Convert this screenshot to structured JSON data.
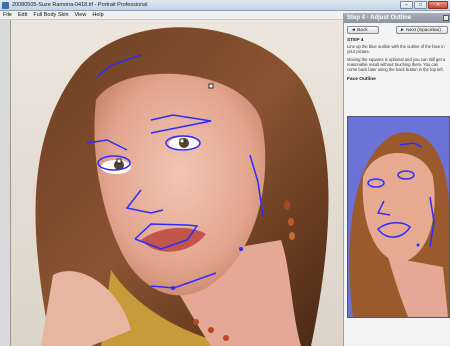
{
  "window": {
    "title": "20080505-Suze Ramona-0418.tif - Portrait Professional",
    "minimize_label": "–",
    "maximize_label": "□",
    "close_label": "✕"
  },
  "menu": {
    "items": [
      "File",
      "Edit",
      "Full Body Skin",
      "View",
      "Help"
    ]
  },
  "panel": {
    "header": "Step 4 - Adjust Outline",
    "back_label": "◄ Back",
    "next_label": "► Next (Spacebar)",
    "step_title": "STEP 4",
    "paragraph1": "Line up the blue outline with the outline of the face in your picture.",
    "paragraph2": "Moving the squares is optional and you can still get a reasonable result without touching them. You can come back later using the back button in the top left.",
    "section_title": "Face Outline"
  },
  "colors": {
    "outline": "#2c2cff",
    "panel_header": "#8a95a3",
    "thumb_bg": "#6b73d6"
  }
}
